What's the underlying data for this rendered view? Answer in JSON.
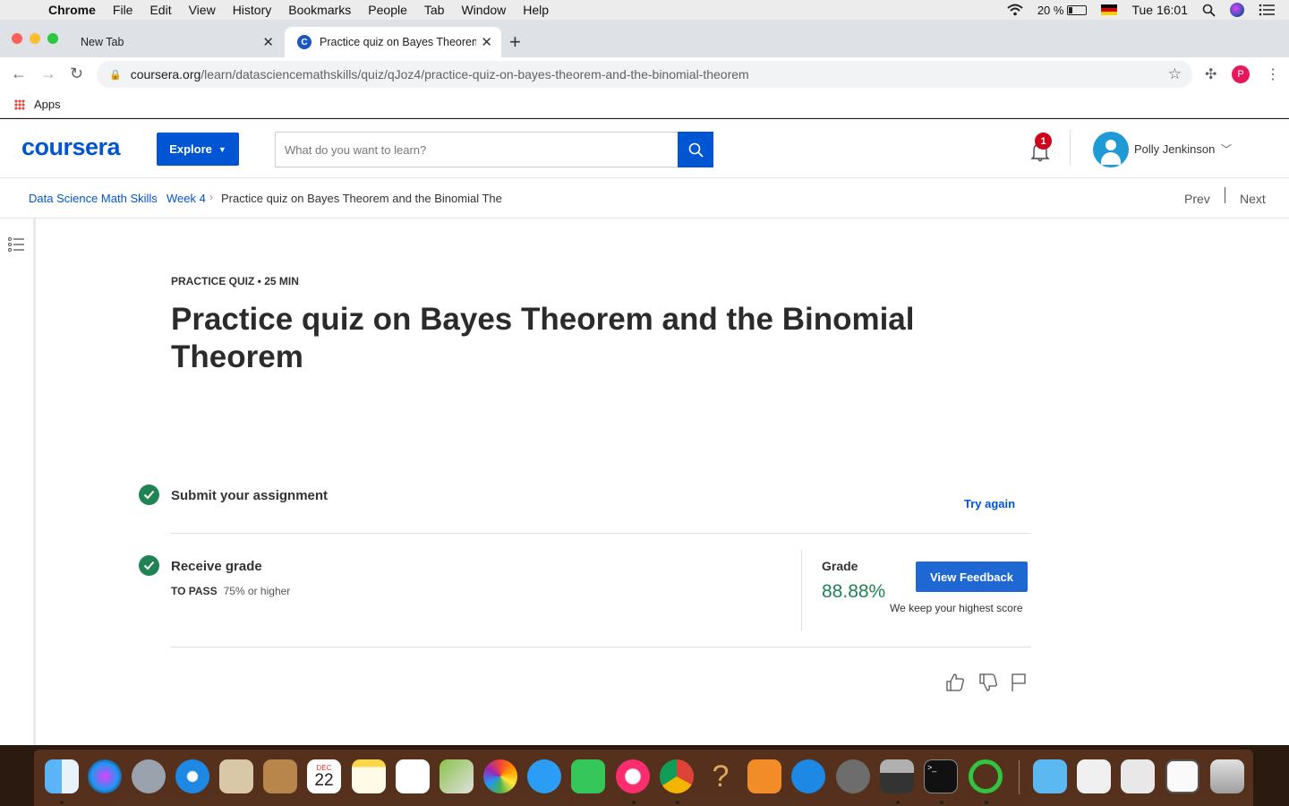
{
  "menubar": {
    "apple_icon": "apple-icon",
    "items": [
      "Chrome",
      "File",
      "Edit",
      "View",
      "History",
      "Bookmarks",
      "People",
      "Tab",
      "Window",
      "Help"
    ],
    "battery": "20 %",
    "clock": "Tue 16:01"
  },
  "browser": {
    "tabs": [
      {
        "label": "New Tab"
      },
      {
        "label": "Practice quiz on Bayes Theorem and the Binomial Theorem"
      }
    ],
    "url_domain": "coursera.org",
    "url_path": "/learn/datasciencemathskills/quiz/qJoz4/practice-quiz-on-bayes-theorem-and-the-binomial-theorem",
    "profile_initial": "P",
    "bookmarks_apps": "Apps"
  },
  "header": {
    "logo": "coursera",
    "explore_label": "Explore",
    "search_placeholder": "What do you want to learn?",
    "notification_count": "1",
    "user_name": "Polly Jenkinson"
  },
  "breadcrumb": {
    "items": [
      "Data Science Math Skills",
      "Week 4"
    ],
    "current": "Practice quiz on Bayes Theorem and the Binomial The",
    "prev": "Prev",
    "next": "Next"
  },
  "quiz": {
    "type_label": "PRACTICE QUIZ • 25 MIN",
    "title": "Practice quiz on Bayes Theorem and the Binomial Theorem",
    "submit_step": "Submit your assignment",
    "try_again": "Try again",
    "receive_step": "Receive grade",
    "to_pass_label": "TO PASS",
    "to_pass_value": "75% or higher",
    "grade_label": "Grade",
    "grade_value": "88.88%",
    "view_feedback": "View Feedback",
    "highest_note": "We keep your highest score"
  },
  "colors": {
    "brand_blue": "#0056d2",
    "success_green": "#1f8354",
    "notification_red": "#d0021b"
  },
  "dock_apps": [
    "Finder",
    "Siri",
    "Launchpad",
    "Safari",
    "Mail",
    "Contacts",
    "Calendar",
    "Notes",
    "Reminders",
    "Maps",
    "Photos",
    "Messages",
    "FaceTime",
    "iTunes",
    "Chrome",
    "Help",
    "Books",
    "App Store",
    "System Preferences",
    "Preview",
    "Terminal",
    "Activity",
    "Downloads",
    "Screenshots",
    "Documents",
    "Desktop",
    "Trash"
  ],
  "dock_calendar_month": "DEC",
  "dock_calendar_day": "22"
}
